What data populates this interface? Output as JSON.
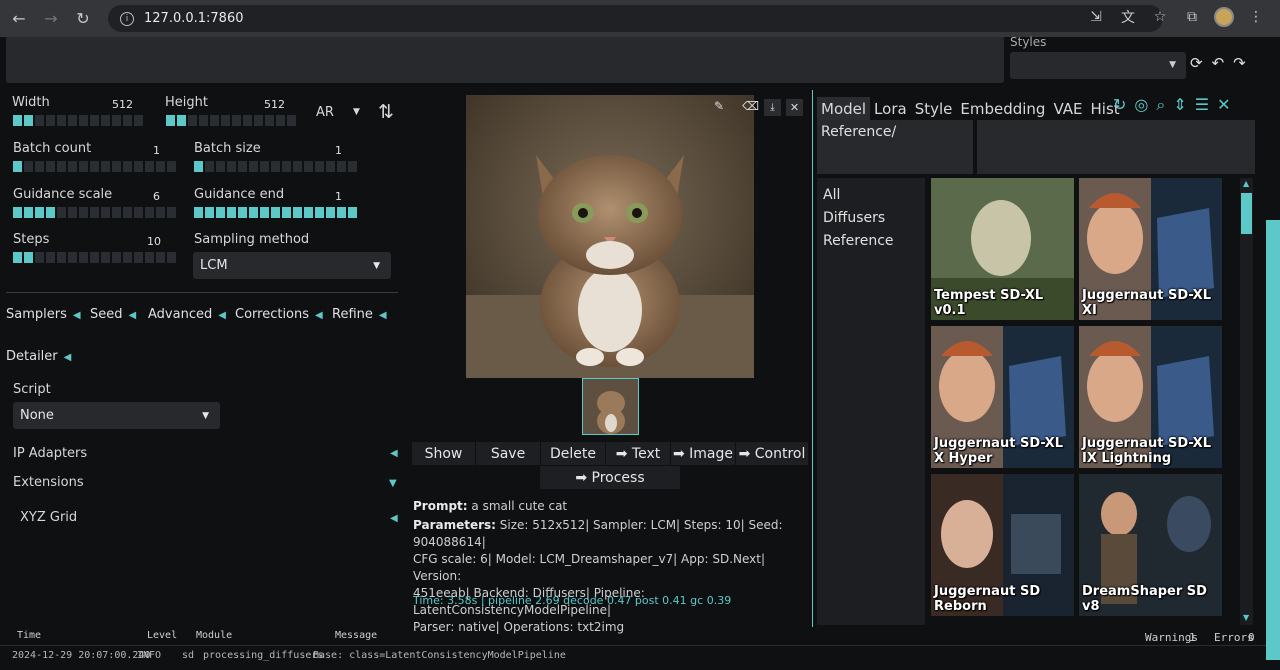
{
  "browser": {
    "url": "127.0.0.1:7860"
  },
  "top": {
    "styles_label": "Styles"
  },
  "params": {
    "width_label": "Width",
    "width_value": "512",
    "height_label": "Height",
    "height_value": "512",
    "ar_label": "AR",
    "batch_count_label": "Batch count",
    "batch_count_value": "1",
    "batch_size_label": "Batch size",
    "batch_size_value": "1",
    "guidance_scale_label": "Guidance scale",
    "guidance_scale_value": "6",
    "guidance_end_label": "Guidance end",
    "guidance_end_value": "1",
    "steps_label": "Steps",
    "steps_value": "10",
    "sampling_method_label": "Sampling method",
    "sampling_method_value": "LCM"
  },
  "accordions": {
    "tabs": [
      "Samplers",
      "Seed",
      "Advanced",
      "Corrections",
      "Refine"
    ],
    "detailer": "Detailer",
    "script_label": "Script",
    "script_value": "None",
    "ip_adapters": "IP Adapters",
    "extensions": "Extensions",
    "xyz_grid": "XYZ Grid"
  },
  "output": {
    "buttons": {
      "show": "Show",
      "save": "Save",
      "delete": "Delete",
      "text": "➡ Text",
      "image": "➡ Image",
      "control": "➡ Control",
      "process": "➡ Process"
    },
    "prompt_label": "Prompt:",
    "prompt_value": "a small cute cat",
    "parameters_label": "Parameters:",
    "parameters_line1": "Size: 512x512| Sampler: LCM| Steps: 10| Seed: 904088614|",
    "parameters_line2": "CFG scale: 6| Model: LCM_Dreamshaper_v7| App: SD.Next| Version:",
    "parameters_line3": "451eeab| Backend: Diffusers| Pipeline: LatentConsistencyModelPipeline|",
    "parameters_line4": "Parser: native| Operations: txt2img",
    "time": "Time: 3.58s | pipeline 2.69 decode 0.47 post 0.41 gc 0.39"
  },
  "networks": {
    "tabs": [
      "Model",
      "Lora",
      "Style",
      "Embedding",
      "VAE",
      "Hist"
    ],
    "reference_path": "Reference/",
    "folders": [
      "All",
      "Diffusers",
      "Reference"
    ],
    "cards": [
      {
        "title": "Tempest SD-XL v0.1"
      },
      {
        "title": "Juggernaut SD-XL XI"
      },
      {
        "title": "Juggernaut SD-XL X Hyper"
      },
      {
        "title": "Juggernaut SD-XL IX Lightning"
      },
      {
        "title": "Juggernaut SD Reborn"
      },
      {
        "title": "DreamShaper SD v8"
      }
    ]
  },
  "log": {
    "col_time": "Time",
    "col_level": "Level",
    "col_module": "Module",
    "col_message": "Message",
    "warnings_label": "Warnings",
    "warnings_count": "1",
    "errors_label": "Errors",
    "errors_count": "0",
    "line_time": "2024-12-29 20:07:00.240",
    "line_level": "INFO",
    "line_module": "sd",
    "line_func": "processing_diffusers",
    "line_message": "Base: class=LatentConsistencyModelPipeline"
  }
}
